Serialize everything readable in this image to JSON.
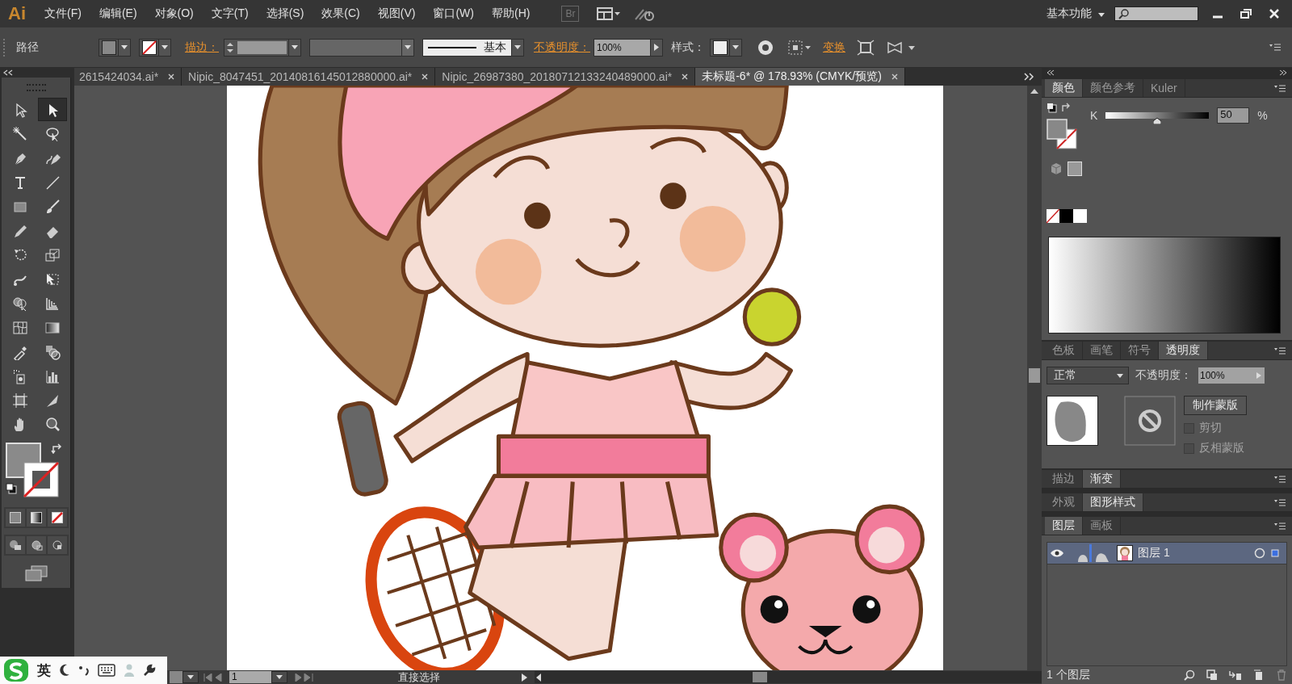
{
  "menubar": {
    "logo": "Ai",
    "menus": [
      "文件(F)",
      "编辑(E)",
      "对象(O)",
      "文字(T)",
      "选择(S)",
      "效果(C)",
      "视图(V)",
      "窗口(W)",
      "帮助(H)"
    ],
    "bridge": "Br",
    "workspace": "基本功能"
  },
  "control_bar": {
    "object_type": "路径",
    "stroke_label": "描边：",
    "stroke_profile": "基本",
    "opacity_label": "不透明度：",
    "opacity": "100%",
    "style_label": "样式：",
    "transform_label": "变换"
  },
  "document_tabs": [
    {
      "label": "2615424034.ai*",
      "selected": false
    },
    {
      "label": "Nipic_8047451_20140816145012880000.ai*",
      "selected": false
    },
    {
      "label": "Nipic_26987380_20180712133240489000.ai*",
      "selected": false
    },
    {
      "label": "未标题-6* @ 178.93% (CMYK/预览)",
      "selected": true
    }
  ],
  "tools": [
    {
      "kind": "selection",
      "selected": false
    },
    {
      "kind": "direct-selection",
      "selected": true
    },
    {
      "kind": "magic-wand",
      "selected": false
    },
    {
      "kind": "lasso",
      "selected": false
    },
    {
      "kind": "pen",
      "selected": false
    },
    {
      "kind": "curvature",
      "selected": false
    },
    {
      "kind": "type",
      "selected": false
    },
    {
      "kind": "line",
      "selected": false
    },
    {
      "kind": "rectangle",
      "selected": false
    },
    {
      "kind": "brush",
      "selected": false
    },
    {
      "kind": "pencil",
      "selected": false
    },
    {
      "kind": "eraser",
      "selected": false
    },
    {
      "kind": "rotate",
      "selected": false
    },
    {
      "kind": "scale",
      "selected": false
    },
    {
      "kind": "warp",
      "selected": false
    },
    {
      "kind": "free-transform",
      "selected": false
    },
    {
      "kind": "shape-builder",
      "selected": false
    },
    {
      "kind": "perspective",
      "selected": false
    },
    {
      "kind": "mesh",
      "selected": false
    },
    {
      "kind": "gradient",
      "selected": false
    },
    {
      "kind": "eyedropper",
      "selected": false
    },
    {
      "kind": "blend",
      "selected": false
    },
    {
      "kind": "sprayer",
      "selected": false
    },
    {
      "kind": "graph",
      "selected": false
    },
    {
      "kind": "artboard",
      "selected": false
    },
    {
      "kind": "slice",
      "selected": false
    },
    {
      "kind": "hand",
      "selected": false
    },
    {
      "kind": "zoom",
      "selected": false
    }
  ],
  "color_panel": {
    "tabs": [
      {
        "label": "颜色",
        "selected": true
      },
      {
        "label": "颜色参考",
        "selected": false
      },
      {
        "label": "Kuler",
        "selected": false
      }
    ],
    "channel": "K",
    "level": 0.5,
    "value": "50",
    "unit": "%"
  },
  "transparency_panel": {
    "tabs": [
      {
        "label": "色板",
        "selected": false
      },
      {
        "label": "画笔",
        "selected": false
      },
      {
        "label": "符号",
        "selected": false
      },
      {
        "label": "透明度",
        "selected": true
      }
    ],
    "blend_mode": "正常",
    "opacity_label": "不透明度：",
    "opacity": "100%",
    "mask_button": "制作蒙版",
    "options": [
      {
        "label": "剪切",
        "checked": false,
        "disabled": true
      },
      {
        "label": "反相蒙版",
        "checked": false,
        "disabled": true
      }
    ]
  },
  "stroke_panel": {
    "tabs": [
      {
        "label": "描边",
        "selected": false
      },
      {
        "label": "渐变",
        "selected": true
      }
    ]
  },
  "appearance_panel": {
    "tabs": [
      {
        "label": "外观",
        "selected": false
      },
      {
        "label": "图形样式",
        "selected": true
      }
    ]
  },
  "layers_panel": {
    "tabs": [
      {
        "label": "图层",
        "selected": true
      },
      {
        "label": "画板",
        "selected": false
      }
    ],
    "layers": [
      {
        "name": "图层 1",
        "visible": true,
        "selected": true
      }
    ],
    "count": "1 个图层"
  },
  "status_bar": {
    "artboard": "1",
    "tool": "直接选择"
  },
  "ime_toolbar": {
    "mode": "英"
  }
}
